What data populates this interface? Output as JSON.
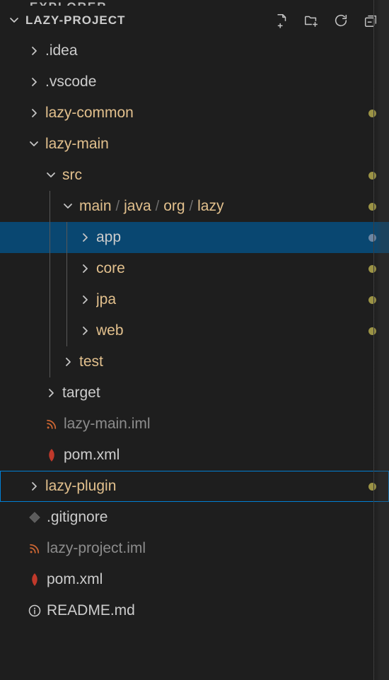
{
  "panelLabel": "EXPLORER",
  "header": {
    "title": "LAZY-PROJECT"
  },
  "tree": [
    {
      "kind": "folder",
      "expanded": false,
      "label": ".idea",
      "color": "white",
      "indent": 1
    },
    {
      "kind": "folder",
      "expanded": false,
      "label": ".vscode",
      "color": "white",
      "indent": 1
    },
    {
      "kind": "folder",
      "expanded": false,
      "label": "lazy-common",
      "color": "yellow",
      "indent": 1,
      "dot": "olive"
    },
    {
      "kind": "folder",
      "expanded": true,
      "label": "lazy-main",
      "color": "yellow",
      "indent": 1
    },
    {
      "kind": "folder",
      "expanded": true,
      "label": "src",
      "color": "yellow",
      "indent": 2,
      "dot": "olive"
    },
    {
      "kind": "folder",
      "expanded": true,
      "breadcrumb": [
        "main",
        "java",
        "org",
        "lazy"
      ],
      "color": "yellow",
      "indent": 3,
      "dot": "olive",
      "guide": [
        2
      ]
    },
    {
      "kind": "folder",
      "expanded": false,
      "label": "app",
      "color": "white",
      "indent": 4,
      "dot": "blue",
      "selected": true,
      "guide": [
        2,
        3
      ]
    },
    {
      "kind": "folder",
      "expanded": false,
      "label": "core",
      "color": "yellow",
      "indent": 4,
      "dot": "olive",
      "guide": [
        2,
        3
      ]
    },
    {
      "kind": "folder",
      "expanded": false,
      "label": "jpa",
      "color": "yellow",
      "indent": 4,
      "dot": "olive",
      "guide": [
        2,
        3
      ]
    },
    {
      "kind": "folder",
      "expanded": false,
      "label": "web",
      "color": "yellow",
      "indent": 4,
      "dot": "olive",
      "guide": [
        2,
        3
      ]
    },
    {
      "kind": "folder",
      "expanded": false,
      "label": "test",
      "color": "yellow",
      "indent": 3,
      "guide": [
        2
      ]
    },
    {
      "kind": "folder",
      "expanded": false,
      "label": "target",
      "color": "white",
      "indent": 2
    },
    {
      "kind": "file",
      "icon": "rss",
      "iconColor": "#cc6633",
      "label": "lazy-main.iml",
      "color": "dim",
      "indent": 2
    },
    {
      "kind": "file",
      "icon": "leaf",
      "iconColor": "#c0392b",
      "label": "pom.xml",
      "color": "white",
      "indent": 2
    },
    {
      "kind": "folder",
      "expanded": false,
      "label": "lazy-plugin",
      "color": "yellow",
      "indent": 1,
      "dot": "olive",
      "outlined": true
    },
    {
      "kind": "file",
      "icon": "diamond",
      "iconColor": "#5c5c5c",
      "label": ".gitignore",
      "color": "white",
      "indent": 1
    },
    {
      "kind": "file",
      "icon": "rss",
      "iconColor": "#cc6633",
      "label": "lazy-project.iml",
      "color": "dim",
      "indent": 1
    },
    {
      "kind": "file",
      "icon": "leaf",
      "iconColor": "#c0392b",
      "label": "pom.xml",
      "color": "white",
      "indent": 1
    },
    {
      "kind": "file",
      "icon": "info",
      "iconColor": "#cccccc",
      "label": "README.md",
      "color": "white",
      "indent": 1
    }
  ]
}
